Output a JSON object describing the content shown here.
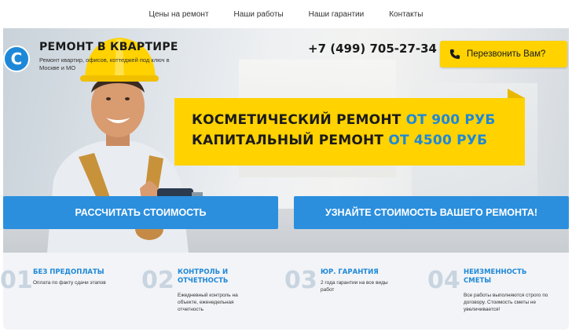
{
  "nav": {
    "items": [
      "Цены на ремонт",
      "Наши работы",
      "Наши гарантии",
      "Контакты"
    ]
  },
  "logo": {
    "letter": "С",
    "title": "РЕМОНТ В КВАРТИРЕ",
    "subtitle": "Ремонт квартир, офисов, коттеджей под ключ в Москве и МО"
  },
  "header": {
    "phone": "+7 (499) 705-27-34",
    "callback_label": "Перезвонить Вам?"
  },
  "banner": {
    "line1_text": "КОСМЕТИЧЕСКИЙ РЕМОНТ ",
    "line1_price": "ОТ 900 РУБ",
    "line2_text": "КАПИТАЛЬНЫЙ РЕМОНТ ",
    "line2_price": "ОТ 4500 РУБ"
  },
  "buttons": {
    "calc": "РАССЧИТАТЬ СТОИМОСТЬ",
    "learn": "УЗНАЙТЕ СТОИМОСТЬ ВАШЕГО РЕМОНТА!"
  },
  "features": [
    {
      "num": "01",
      "title": "БЕЗ ПРЕДОПЛАТЫ",
      "desc": "Оплата по факту сдачи этапов"
    },
    {
      "num": "02",
      "title": "КОНТРОЛЬ И ОТЧЕТНОСТЬ",
      "desc": "Ежедневный контроль на объекте, еженедельная отчетность"
    },
    {
      "num": "03",
      "title": "ЮР. ГАРАНТИЯ",
      "desc": "2 года гарантии на все виды работ"
    },
    {
      "num": "04",
      "title": "НЕИЗМЕННОСТЬ СМЕТЫ",
      "desc": "Все работы выполняются строго по договору. Стоимость сметы не увеличивается!"
    }
  ],
  "colors": {
    "accent_blue": "#1e88d8",
    "button_blue": "#2b8fde",
    "accent_yellow": "#ffd200"
  }
}
